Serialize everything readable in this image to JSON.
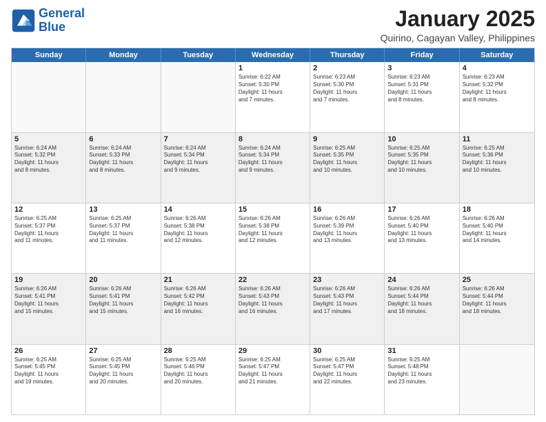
{
  "header": {
    "logo_line1": "General",
    "logo_line2": "Blue",
    "month": "January 2025",
    "location": "Quirino, Cagayan Valley, Philippines"
  },
  "weekdays": [
    "Sunday",
    "Monday",
    "Tuesday",
    "Wednesday",
    "Thursday",
    "Friday",
    "Saturday"
  ],
  "rows": [
    [
      {
        "day": "",
        "info": "",
        "shaded": false,
        "empty": true
      },
      {
        "day": "",
        "info": "",
        "shaded": false,
        "empty": true
      },
      {
        "day": "",
        "info": "",
        "shaded": false,
        "empty": true
      },
      {
        "day": "1",
        "info": "Sunrise: 6:22 AM\nSunset: 5:30 PM\nDaylight: 11 hours\nand 7 minutes.",
        "shaded": false,
        "empty": false
      },
      {
        "day": "2",
        "info": "Sunrise: 6:23 AM\nSunset: 5:30 PM\nDaylight: 11 hours\nand 7 minutes.",
        "shaded": false,
        "empty": false
      },
      {
        "day": "3",
        "info": "Sunrise: 6:23 AM\nSunset: 5:31 PM\nDaylight: 11 hours\nand 8 minutes.",
        "shaded": false,
        "empty": false
      },
      {
        "day": "4",
        "info": "Sunrise: 6:23 AM\nSunset: 5:32 PM\nDaylight: 11 hours\nand 8 minutes.",
        "shaded": false,
        "empty": false
      }
    ],
    [
      {
        "day": "5",
        "info": "Sunrise: 6:24 AM\nSunset: 5:32 PM\nDaylight: 11 hours\nand 8 minutes.",
        "shaded": true,
        "empty": false
      },
      {
        "day": "6",
        "info": "Sunrise: 6:24 AM\nSunset: 5:33 PM\nDaylight: 11 hours\nand 8 minutes.",
        "shaded": true,
        "empty": false
      },
      {
        "day": "7",
        "info": "Sunrise: 6:24 AM\nSunset: 5:34 PM\nDaylight: 11 hours\nand 9 minutes.",
        "shaded": true,
        "empty": false
      },
      {
        "day": "8",
        "info": "Sunrise: 6:24 AM\nSunset: 5:34 PM\nDaylight: 11 hours\nand 9 minutes.",
        "shaded": true,
        "empty": false
      },
      {
        "day": "9",
        "info": "Sunrise: 6:25 AM\nSunset: 5:35 PM\nDaylight: 11 hours\nand 10 minutes.",
        "shaded": true,
        "empty": false
      },
      {
        "day": "10",
        "info": "Sunrise: 6:25 AM\nSunset: 5:35 PM\nDaylight: 11 hours\nand 10 minutes.",
        "shaded": true,
        "empty": false
      },
      {
        "day": "11",
        "info": "Sunrise: 6:25 AM\nSunset: 5:36 PM\nDaylight: 11 hours\nand 10 minutes.",
        "shaded": true,
        "empty": false
      }
    ],
    [
      {
        "day": "12",
        "info": "Sunrise: 6:25 AM\nSunset: 5:37 PM\nDaylight: 11 hours\nand 11 minutes.",
        "shaded": false,
        "empty": false
      },
      {
        "day": "13",
        "info": "Sunrise: 6:25 AM\nSunset: 5:37 PM\nDaylight: 11 hours\nand 11 minutes.",
        "shaded": false,
        "empty": false
      },
      {
        "day": "14",
        "info": "Sunrise: 6:26 AM\nSunset: 5:38 PM\nDaylight: 11 hours\nand 12 minutes.",
        "shaded": false,
        "empty": false
      },
      {
        "day": "15",
        "info": "Sunrise: 6:26 AM\nSunset: 5:38 PM\nDaylight: 11 hours\nand 12 minutes.",
        "shaded": false,
        "empty": false
      },
      {
        "day": "16",
        "info": "Sunrise: 6:26 AM\nSunset: 5:39 PM\nDaylight: 11 hours\nand 13 minutes.",
        "shaded": false,
        "empty": false
      },
      {
        "day": "17",
        "info": "Sunrise: 6:26 AM\nSunset: 5:40 PM\nDaylight: 11 hours\nand 13 minutes.",
        "shaded": false,
        "empty": false
      },
      {
        "day": "18",
        "info": "Sunrise: 6:26 AM\nSunset: 5:40 PM\nDaylight: 11 hours\nand 14 minutes.",
        "shaded": false,
        "empty": false
      }
    ],
    [
      {
        "day": "19",
        "info": "Sunrise: 6:26 AM\nSunset: 5:41 PM\nDaylight: 11 hours\nand 15 minutes.",
        "shaded": true,
        "empty": false
      },
      {
        "day": "20",
        "info": "Sunrise: 6:26 AM\nSunset: 5:41 PM\nDaylight: 11 hours\nand 15 minutes.",
        "shaded": true,
        "empty": false
      },
      {
        "day": "21",
        "info": "Sunrise: 6:26 AM\nSunset: 5:42 PM\nDaylight: 11 hours\nand 16 minutes.",
        "shaded": true,
        "empty": false
      },
      {
        "day": "22",
        "info": "Sunrise: 6:26 AM\nSunset: 5:43 PM\nDaylight: 11 hours\nand 16 minutes.",
        "shaded": true,
        "empty": false
      },
      {
        "day": "23",
        "info": "Sunrise: 6:26 AM\nSunset: 5:43 PM\nDaylight: 11 hours\nand 17 minutes.",
        "shaded": true,
        "empty": false
      },
      {
        "day": "24",
        "info": "Sunrise: 6:26 AM\nSunset: 5:44 PM\nDaylight: 11 hours\nand 18 minutes.",
        "shaded": true,
        "empty": false
      },
      {
        "day": "25",
        "info": "Sunrise: 6:26 AM\nSunset: 5:44 PM\nDaylight: 11 hours\nand 18 minutes.",
        "shaded": true,
        "empty": false
      }
    ],
    [
      {
        "day": "26",
        "info": "Sunrise: 6:25 AM\nSunset: 5:45 PM\nDaylight: 11 hours\nand 19 minutes.",
        "shaded": false,
        "empty": false
      },
      {
        "day": "27",
        "info": "Sunrise: 6:25 AM\nSunset: 5:45 PM\nDaylight: 11 hours\nand 20 minutes.",
        "shaded": false,
        "empty": false
      },
      {
        "day": "28",
        "info": "Sunrise: 6:25 AM\nSunset: 5:46 PM\nDaylight: 11 hours\nand 20 minutes.",
        "shaded": false,
        "empty": false
      },
      {
        "day": "29",
        "info": "Sunrise: 6:25 AM\nSunset: 5:47 PM\nDaylight: 11 hours\nand 21 minutes.",
        "shaded": false,
        "empty": false
      },
      {
        "day": "30",
        "info": "Sunrise: 6:25 AM\nSunset: 5:47 PM\nDaylight: 11 hours\nand 22 minutes.",
        "shaded": false,
        "empty": false
      },
      {
        "day": "31",
        "info": "Sunrise: 6:25 AM\nSunset: 5:48 PM\nDaylight: 11 hours\nand 23 minutes.",
        "shaded": false,
        "empty": false
      },
      {
        "day": "",
        "info": "",
        "shaded": false,
        "empty": true
      }
    ]
  ]
}
